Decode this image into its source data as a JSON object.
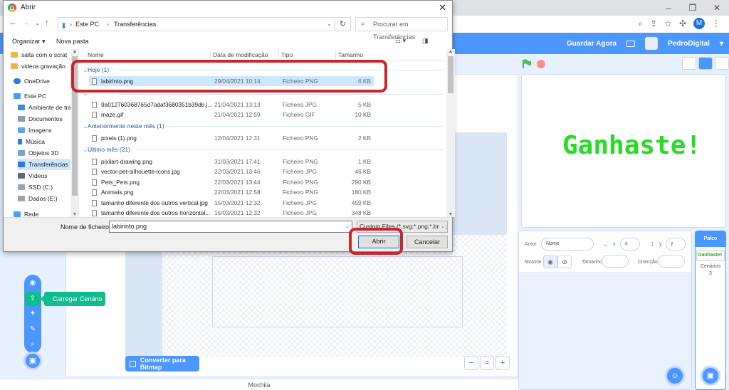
{
  "browser": {
    "window_controls": [
      "–",
      "❐",
      "✕"
    ]
  },
  "scratch": {
    "save_now": "Guardar Agora",
    "username": "PedroDigital",
    "convert_bitmap": "Converter para Bitmap",
    "upload_backdrop_tooltip": "Carregar Cenário",
    "backpack": "Mochila",
    "stage_text": "Ganhaste!",
    "sprite_label": "Actor",
    "sprite_name_placeholder": "Nome",
    "x_label": "x",
    "x_placeholder": "x",
    "y_label": "y",
    "y_placeholder": "y",
    "show_label": "Mostrar",
    "size_label": "Tamanho",
    "direction_label": "Direcção",
    "stage_panel_title": "Palco",
    "stage_thumb_text": "Ganhaste!",
    "backdrops_label": "Cenários",
    "backdrops_count": "3",
    "colors": {
      "primary": "#4c97ff",
      "green": "#0fbd8c",
      "stage_text": "#22dd22"
    }
  },
  "dialog": {
    "title": "Abrir",
    "close": "✕",
    "breadcrumb": [
      "Este PC",
      "Transferências"
    ],
    "search_placeholder": "Procurar em Transferências",
    "organize": "Organizar ▾",
    "new_folder": "Nova pasta",
    "nav_items": [
      "salta com o scrat",
      "videos gravação",
      "OneDrive",
      "Este PC",
      "Ambiente de trab",
      "Documentos",
      "Imagens",
      "Música",
      "Objetos 3D",
      "Transferências",
      "Vídeos",
      "SSD (C:)",
      "Dados (E:)",
      "Rede"
    ],
    "columns": [
      "Nome",
      "Data de modificação",
      "Tipo",
      "Tamanho"
    ],
    "groups": [
      {
        "label": "Hoje (1)",
        "files": [
          {
            "name": "labirinto.png",
            "date": "29/04/2021 10:14",
            "type": "Ficheiro PNG",
            "size": "6 KB"
          }
        ]
      },
      {
        "label": "",
        "files": [
          {
            "name": "9a012760368765d7adaf3680351b39db.j...",
            "date": "21/04/2021 13:13",
            "type": "Ficheiro JPG",
            "size": "5 KB"
          },
          {
            "name": "maze.gif",
            "date": "21/04/2021 12:59",
            "type": "Ficheiro GIF",
            "size": "10 KB"
          }
        ]
      },
      {
        "label": "Anteriormente neste mês (1)",
        "files": [
          {
            "name": "pixels (1).png",
            "date": "12/04/2021 12:31",
            "type": "Ficheiro PNG",
            "size": "2 KB"
          }
        ]
      },
      {
        "label": "Último mês (21)",
        "files": [
          {
            "name": "pixilart-drawing.png",
            "date": "31/03/2021 17:41",
            "type": "Ficheiro PNG",
            "size": "1 KB"
          },
          {
            "name": "vector-pet-silhouette-icons.jpg",
            "date": "22/03/2021 13:46",
            "type": "Ficheiro JPG",
            "size": "46 KB"
          },
          {
            "name": "Pets_Pets.png",
            "date": "22/03/2021 13:44",
            "type": "Ficheiro PNG",
            "size": "290 KB"
          },
          {
            "name": "Animais.png",
            "date": "22/03/2021 12:58",
            "type": "Ficheiro PNG",
            "size": "180 KB"
          },
          {
            "name": "tamanho diferente dos outros vertical.jpg",
            "date": "15/03/2021 12:32",
            "type": "Ficheiro JPG",
            "size": "459 KB"
          },
          {
            "name": "tamanho diferente dos outros horizontal...",
            "date": "15/03/2021 12:32",
            "type": "Ficheiro JPG",
            "size": "348 KB"
          }
        ]
      }
    ],
    "filename_label": "Nome de ficheiro:",
    "filename_value": "labirinto.png",
    "filter_value": "Custom Files (*.svg;*.png;*.bmp;",
    "open_button": "Abrir",
    "cancel_button": "Cancelar",
    "highlight_color": "#c8252c"
  }
}
